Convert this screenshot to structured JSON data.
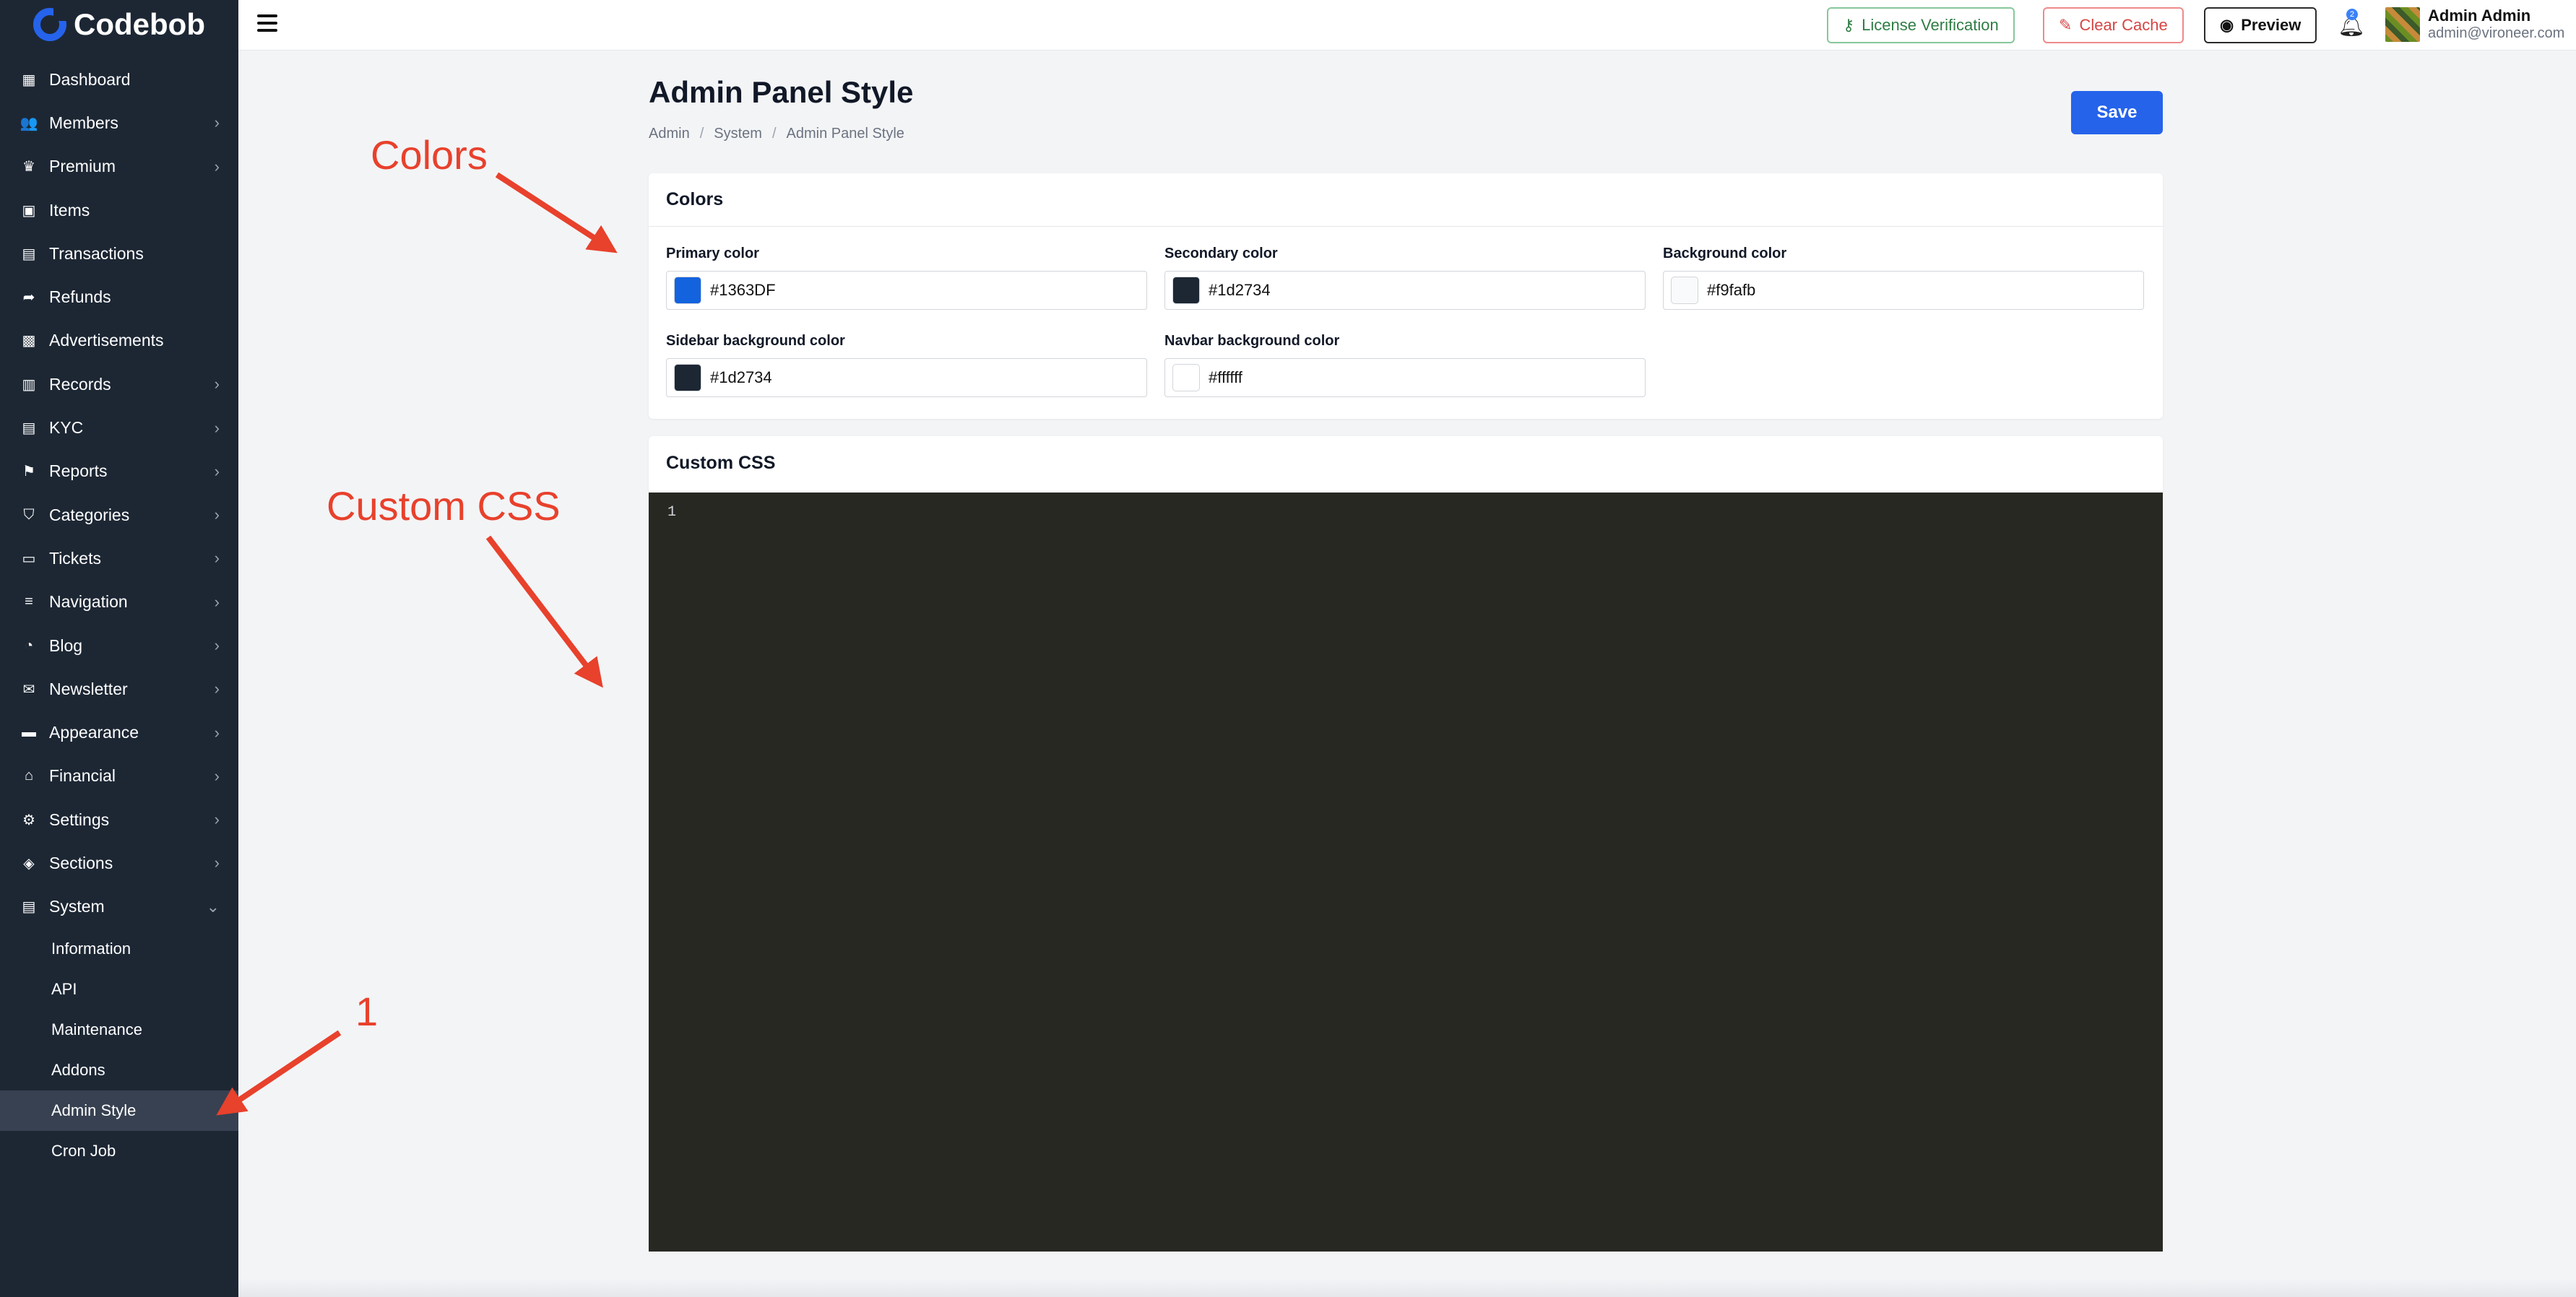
{
  "app": {
    "name": "Codebob"
  },
  "sidebar": {
    "items": [
      {
        "label": "Dashboard",
        "icon": "dashboard-icon",
        "glyph": "▦",
        "chevron": ""
      },
      {
        "label": "Members",
        "icon": "users-icon",
        "glyph": "👥",
        "chevron": "›"
      },
      {
        "label": "Premium",
        "icon": "crown-icon",
        "glyph": "♛",
        "chevron": "›"
      },
      {
        "label": "Items",
        "icon": "photos-icon",
        "glyph": "▣",
        "chevron": ""
      },
      {
        "label": "Transactions",
        "icon": "receipt-icon",
        "glyph": "▤",
        "chevron": ""
      },
      {
        "label": "Refunds",
        "icon": "share-icon",
        "glyph": "➦",
        "chevron": ""
      },
      {
        "label": "Advertisements",
        "icon": "ad-icon",
        "glyph": "▩",
        "chevron": ""
      },
      {
        "label": "Records",
        "icon": "records-icon",
        "glyph": "▥",
        "chevron": "›"
      },
      {
        "label": "KYC",
        "icon": "id-card-icon",
        "glyph": "▤",
        "chevron": "›"
      },
      {
        "label": "Reports",
        "icon": "flag-icon",
        "glyph": "⚑",
        "chevron": "›"
      },
      {
        "label": "Categories",
        "icon": "tags-icon",
        "glyph": "⛉",
        "chevron": "›"
      },
      {
        "label": "Tickets",
        "icon": "inbox-icon",
        "glyph": "▭",
        "chevron": "›"
      },
      {
        "label": "Navigation",
        "icon": "menu-icon",
        "glyph": "≡",
        "chevron": "›"
      },
      {
        "label": "Blog",
        "icon": "rss-icon",
        "glyph": "◔",
        "chevron": "›"
      },
      {
        "label": "Newsletter",
        "icon": "envelope-icon",
        "glyph": "✉",
        "chevron": "›"
      },
      {
        "label": "Appearance",
        "icon": "paint-roller-icon",
        "glyph": "▬",
        "chevron": "›"
      },
      {
        "label": "Financial",
        "icon": "bank-icon",
        "glyph": "⌂",
        "chevron": "›"
      },
      {
        "label": "Settings",
        "icon": "gear-icon",
        "glyph": "⚙",
        "chevron": "›"
      },
      {
        "label": "Sections",
        "icon": "layers-icon",
        "glyph": "◈",
        "chevron": "›"
      },
      {
        "label": "System",
        "icon": "server-icon",
        "glyph": "▤",
        "chevron": "⌄"
      }
    ],
    "subitems": [
      {
        "label": "Information",
        "active": false
      },
      {
        "label": "API",
        "active": false
      },
      {
        "label": "Maintenance",
        "active": false
      },
      {
        "label": "Addons",
        "active": false
      },
      {
        "label": "Admin Style",
        "active": true
      },
      {
        "label": "Cron Job",
        "active": false
      }
    ]
  },
  "topbar": {
    "license_label": "License Verification",
    "clear_cache_label": "Clear Cache",
    "preview_label": "Preview",
    "notification_count": "2",
    "user_name": "Admin Admin",
    "user_email": "admin@vironeer.com"
  },
  "page": {
    "title": "Admin Panel Style",
    "breadcrumb": [
      "Admin",
      "System",
      "Admin Panel Style"
    ],
    "save_label": "Save"
  },
  "colors_card": {
    "title": "Colors",
    "fields": [
      {
        "label": "Primary color",
        "value": "#1363DF",
        "swatch": "#1363DF"
      },
      {
        "label": "Secondary color",
        "value": "#1d2734",
        "swatch": "#1d2734"
      },
      {
        "label": "Background color",
        "value": "#f9fafb",
        "swatch": "#f9fafb"
      },
      {
        "label": "Sidebar background color",
        "value": "#1d2734",
        "swatch": "#1d2734"
      },
      {
        "label": "Navbar background color",
        "value": "#ffffff",
        "swatch": "#ffffff"
      }
    ]
  },
  "css_card": {
    "title": "Custom CSS",
    "line_number": "1"
  },
  "annotations": {
    "colors": "Colors",
    "custom_css": "Custom CSS",
    "one": "1"
  }
}
